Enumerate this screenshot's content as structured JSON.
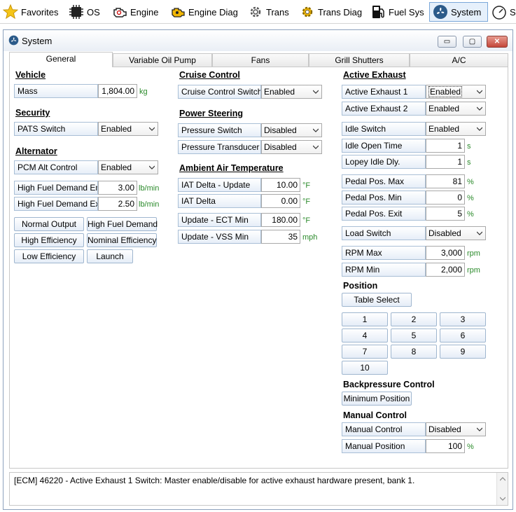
{
  "toolbar": {
    "items": [
      {
        "label": "Favorites",
        "icon": "star-icon"
      },
      {
        "label": "OS",
        "icon": "chip-icon"
      },
      {
        "label": "Engine",
        "icon": "engine-icon"
      },
      {
        "label": "Engine Diag",
        "icon": "engine-diag-icon"
      },
      {
        "label": "Trans",
        "icon": "gear-icon"
      },
      {
        "label": "Trans Diag",
        "icon": "trans-diag-icon"
      },
      {
        "label": "Fuel Sys",
        "icon": "fuel-pump-icon"
      },
      {
        "label": "System",
        "icon": "fan-icon",
        "active": true
      },
      {
        "label": "S",
        "icon": "speedometer-icon"
      }
    ]
  },
  "window": {
    "title": "System",
    "min_label": "▭",
    "max_label": "▢",
    "close_label": "✕"
  },
  "tabs": [
    "General",
    "Variable Oil Pump",
    "Fans",
    "Grill Shutters",
    "A/C"
  ],
  "left": {
    "vehicle": {
      "header": "Vehicle",
      "mass_label": "Mass",
      "mass_value": "1,804.00",
      "mass_unit": "kg"
    },
    "security": {
      "header": "Security",
      "pats_label": "PATS Switch",
      "pats_value": "Enabled"
    },
    "alternator": {
      "header": "Alternator",
      "pcm_label": "PCM Alt Control",
      "pcm_value": "Enabled",
      "hfd_enable_label": "High Fuel Demand Enab",
      "hfd_enable_value": "3.00",
      "hfd_enable_unit": "lb/min",
      "hfd_exit_label": "High Fuel Demand Exit",
      "hfd_exit_value": "2.50",
      "hfd_exit_unit": "lb/min",
      "buttons": [
        "Normal Output",
        "High Fuel Demand",
        "High Efficiency",
        "Nominal Efficiency",
        "Low Efficiency",
        "Launch"
      ]
    }
  },
  "middle": {
    "cruise": {
      "header": "Cruise Control",
      "switch_label": "Cruise Control Switch",
      "switch_value": "Enabled"
    },
    "steering": {
      "header": "Power Steering",
      "pressure_switch_label": "Pressure Switch",
      "pressure_switch_value": "Disabled",
      "transducer_label": "Pressure Transducer",
      "transducer_value": "Disabled"
    },
    "ambient": {
      "header": "Ambient Air Temperature",
      "iat_update_label": "IAT Delta - Update",
      "iat_update_value": "10.00",
      "iat_update_unit": "°F",
      "iat_delta_label": "IAT Delta",
      "iat_delta_value": "0.00",
      "iat_delta_unit": "°F",
      "ect_label": "Update - ECT Min",
      "ect_value": "180.00",
      "ect_unit": "°F",
      "vss_label": "Update - VSS Min",
      "vss_value": "35",
      "vss_unit": "mph"
    }
  },
  "right": {
    "exhaust": {
      "header": "Active Exhaust",
      "ae1_label": "Active Exhaust 1",
      "ae1_value": "Enabled",
      "ae2_label": "Active Exhaust 2",
      "ae2_value": "Enabled",
      "idle_switch_label": "Idle Switch",
      "idle_switch_value": "Enabled",
      "idle_open_label": "Idle Open Time",
      "idle_open_value": "1",
      "idle_open_unit": "s",
      "lopey_label": "Lopey Idle Dly.",
      "lopey_value": "1",
      "lopey_unit": "s",
      "pedal_max_label": "Pedal Pos. Max",
      "pedal_max_value": "81",
      "pedal_max_unit": "%",
      "pedal_min_label": "Pedal Pos. Min",
      "pedal_min_value": "0",
      "pedal_min_unit": "%",
      "pedal_exit_label": "Pedal Pos. Exit",
      "pedal_exit_value": "5",
      "pedal_exit_unit": "%",
      "load_label": "Load Switch",
      "load_value": "Disabled",
      "rpm_max_label": "RPM Max",
      "rpm_max_value": "3,000",
      "rpm_max_unit": "rpm",
      "rpm_min_label": "RPM Min",
      "rpm_min_value": "2,000",
      "rpm_min_unit": "rpm"
    },
    "position": {
      "header": "Position",
      "table_select": "Table Select",
      "numbers": [
        "1",
        "2",
        "3",
        "4",
        "5",
        "6",
        "7",
        "8",
        "9",
        "10"
      ]
    },
    "backpressure": {
      "header": "Backpressure Control",
      "min_position": "Minimum Position"
    },
    "manual": {
      "header": "Manual Control",
      "control_label": "Manual Control",
      "control_value": "Disabled",
      "position_label": "Manual Position",
      "position_value": "100",
      "position_unit": "%"
    }
  },
  "status": {
    "text": "[ECM] 46220 - Active Exhaust 1 Switch: Master enable/disable for active exhaust hardware present, bank 1."
  },
  "colors": {
    "unit_green": "#2a8a2a",
    "label_blue": "#e6eef8",
    "active_tab": "#7aa7d9"
  }
}
